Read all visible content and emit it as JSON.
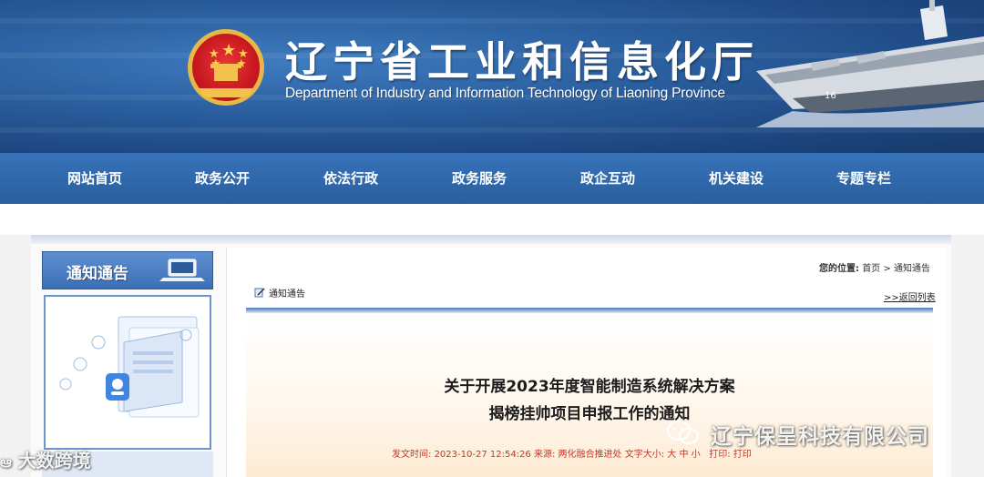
{
  "header": {
    "title_cn": "辽宁省工业和信息化厅",
    "title_en": "Department of Industry and Information Technology of Liaoning Province",
    "emblem_icon": "national-emblem-icon",
    "ship_number": "16"
  },
  "nav": {
    "items": [
      {
        "label": "网站首页"
      },
      {
        "label": "政务公开"
      },
      {
        "label": "依法行政"
      },
      {
        "label": "政务服务"
      },
      {
        "label": "政企互动"
      },
      {
        "label": "机关建设"
      },
      {
        "label": "专题专栏"
      }
    ]
  },
  "sidebar": {
    "heading": "通知通告",
    "icon": "notice-illustration-icon"
  },
  "breadcrumb": {
    "label": "您的位置:",
    "home": "首页",
    "separator": ">",
    "current": "通知通告"
  },
  "section": {
    "title": "通知通告",
    "back_link": ">>返回列表"
  },
  "article": {
    "title_line1": "关于开展2023年度智能制造系统解决方案",
    "title_line2": "揭榜挂帅项目申报工作的通知",
    "meta": {
      "date_label": "发文时间:",
      "date": "2023-10-27 12:54:26",
      "source_label": "来源:",
      "source": "两化融合推进处",
      "font_label": "文字大小:",
      "font_large": "大",
      "font_medium": "中",
      "font_small": "小",
      "print_label": "打印:",
      "print": "打印"
    }
  },
  "watermarks": {
    "left": "大数跨境",
    "right": "辽宁保呈科技有限公司"
  },
  "colors": {
    "nav_bg": "#2f66ab",
    "banner_bg": "#2a5e9e",
    "meta_text": "#c0392b"
  }
}
